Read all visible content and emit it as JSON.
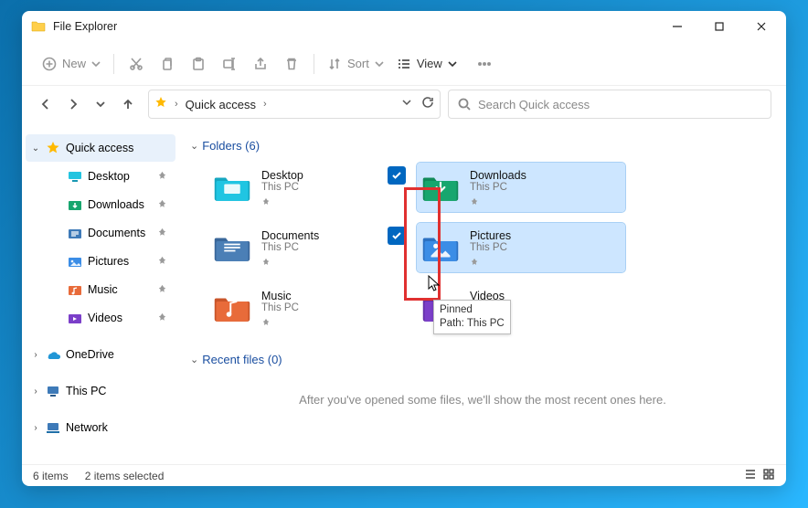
{
  "window": {
    "title": "File Explorer"
  },
  "toolbar": {
    "new": "New",
    "sort": "Sort",
    "view": "View"
  },
  "address": {
    "crumb": "Quick access"
  },
  "search": {
    "placeholder": "Search Quick access"
  },
  "sidebar": {
    "items": [
      {
        "label": "Quick access",
        "expand": "down",
        "icon": "star",
        "selected": true
      },
      {
        "label": "Desktop",
        "icon": "desktop",
        "pinned": true,
        "indent": 2
      },
      {
        "label": "Downloads",
        "icon": "downloads",
        "pinned": true,
        "indent": 2
      },
      {
        "label": "Documents",
        "icon": "documents",
        "pinned": true,
        "indent": 2
      },
      {
        "label": "Pictures",
        "icon": "pictures",
        "pinned": true,
        "indent": 2
      },
      {
        "label": "Music",
        "icon": "music",
        "pinned": true,
        "indent": 2
      },
      {
        "label": "Videos",
        "icon": "videos",
        "pinned": true,
        "indent": 2
      },
      {
        "label": "OneDrive",
        "expand": "right",
        "icon": "onedrive",
        "indent": 0,
        "gapTop": true
      },
      {
        "label": "This PC",
        "expand": "right",
        "icon": "thispc",
        "indent": 0,
        "gapTop": true
      },
      {
        "label": "Network",
        "expand": "right",
        "icon": "network",
        "indent": 0,
        "gapTop": true
      }
    ]
  },
  "folders": {
    "header": "Folders (6)",
    "items": [
      {
        "name": "Desktop",
        "location": "This PC",
        "icon": "desktop",
        "selected": false
      },
      {
        "name": "Downloads",
        "location": "This PC",
        "icon": "downloads",
        "selected": true
      },
      {
        "name": "Documents",
        "location": "This PC",
        "icon": "documents",
        "selected": false
      },
      {
        "name": "Pictures",
        "location": "This PC",
        "icon": "pictures",
        "selected": true
      },
      {
        "name": "Music",
        "location": "This PC",
        "icon": "music",
        "selected": false
      },
      {
        "name": "Videos",
        "location": "This PC",
        "icon": "videos",
        "selected": false
      }
    ]
  },
  "recent": {
    "header": "Recent files (0)",
    "empty_message": "After you've opened some files, we'll show the most recent ones here."
  },
  "tooltip": {
    "line1": "Pinned",
    "line2": "Path: This PC"
  },
  "status": {
    "count": "6 items",
    "selection": "2 items selected"
  },
  "colors": {
    "accent": "#0067c0",
    "highlight": "#e03030",
    "selection_bg": "#cde6ff"
  }
}
